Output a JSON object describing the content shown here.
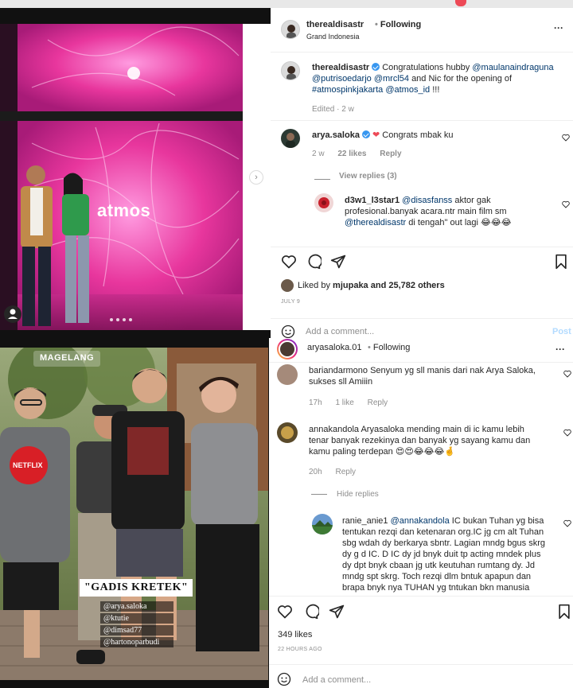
{
  "post1": {
    "header": {
      "username": "therealdisastr",
      "follow_status": "Following",
      "location": "Grand Indonesia",
      "more_label": "···"
    },
    "photo": {
      "overlay_text": "atmos"
    },
    "caption": {
      "username": "therealdisastr",
      "text_1": "Congratulations hubby",
      "mention_1": "@maulanaindraguna",
      "mention_2": "@putrisoedarjo",
      "mention_3": "@mrcl54",
      "text_2": "and Nic for the opening of",
      "hashtag": "#atmospinkjakarta",
      "mention_4": "@atmos_id",
      "text_3": "!!!",
      "edited": "Edited · 2 w"
    },
    "comments": [
      {
        "username": "arya.saloka",
        "text": "Congrats mbak ku",
        "age": "2 w",
        "likes": "22 likes",
        "reply": "Reply",
        "view_replies": "View replies (3)"
      },
      {
        "username": "d3w1_l3star1",
        "mention": "@disasfanss",
        "text_1": "aktor gak profesional.banyak acara.ntr main film sm",
        "mention_2": "@therealdisastr",
        "text_2": "di tengah\" out lagi 😂😂😂"
      }
    ],
    "liked_by_prefix": "Liked by",
    "liked_by_user": "mjupaka",
    "liked_by_suffix": "and 25,782 others",
    "date": "JULY 9",
    "add_comment_placeholder": "Add a comment...",
    "post_label": "Post"
  },
  "post2": {
    "header": {
      "username": "aryasaloka.01",
      "follow_status": "Following",
      "more_label": "···"
    },
    "photo": {
      "location_sticker": "MAGELANG",
      "title_sticker": "\"GADIS KRETEK\"",
      "tags": [
        "@arya.saloka",
        "@ktutie",
        "@dimsad77",
        "@hartonoparbudi"
      ],
      "shirt_logo": "NETFLIX"
    },
    "comments": [
      {
        "username": "bariandarmono",
        "text": "Senyum yg sll manis dari nak Arya Saloka, sukses sll Amiiin",
        "age": "17h",
        "likes": "1 like",
        "reply": "Reply"
      },
      {
        "username": "annakandola",
        "text": "Aryasaloka mending main di ic kamu lebih tenar banyak rezekinya dan banyak yg sayang kamu dan kamu paling terdepan 😍😍😂😂😂🤞",
        "age": "20h",
        "reply": "Reply",
        "hide_replies": "Hide replies"
      },
      {
        "username": "ranie_anie1",
        "mention": "@annakandola",
        "text": "IC bukan Tuhan yg bisa tentukan rezqi dan ketenaran org.IC jg cm alt Tuhan sbg wdah dy berkarya sbntr. Lagian mndg bgus skrg dy g d IC. D IC dy jd bnyk duit tp acting mndek plus dy dpt bnyk cbaan jg utk keutuhan rumtang dy. Jd mndg spt skrg. Toch rezqi dlm bntuk apapun dan brapa bnyk nya TUHAN yg tntukan bkn manusia"
      }
    ],
    "likes": "349 likes",
    "date": "22 HOURS AGO",
    "add_comment_placeholder": "Add a comment..."
  },
  "colors": {
    "pink_bg": "#e8369d",
    "link": "#00376b",
    "muted": "#8e8e8e",
    "verified": "#3897f0",
    "heart_red": "#ed4956"
  }
}
